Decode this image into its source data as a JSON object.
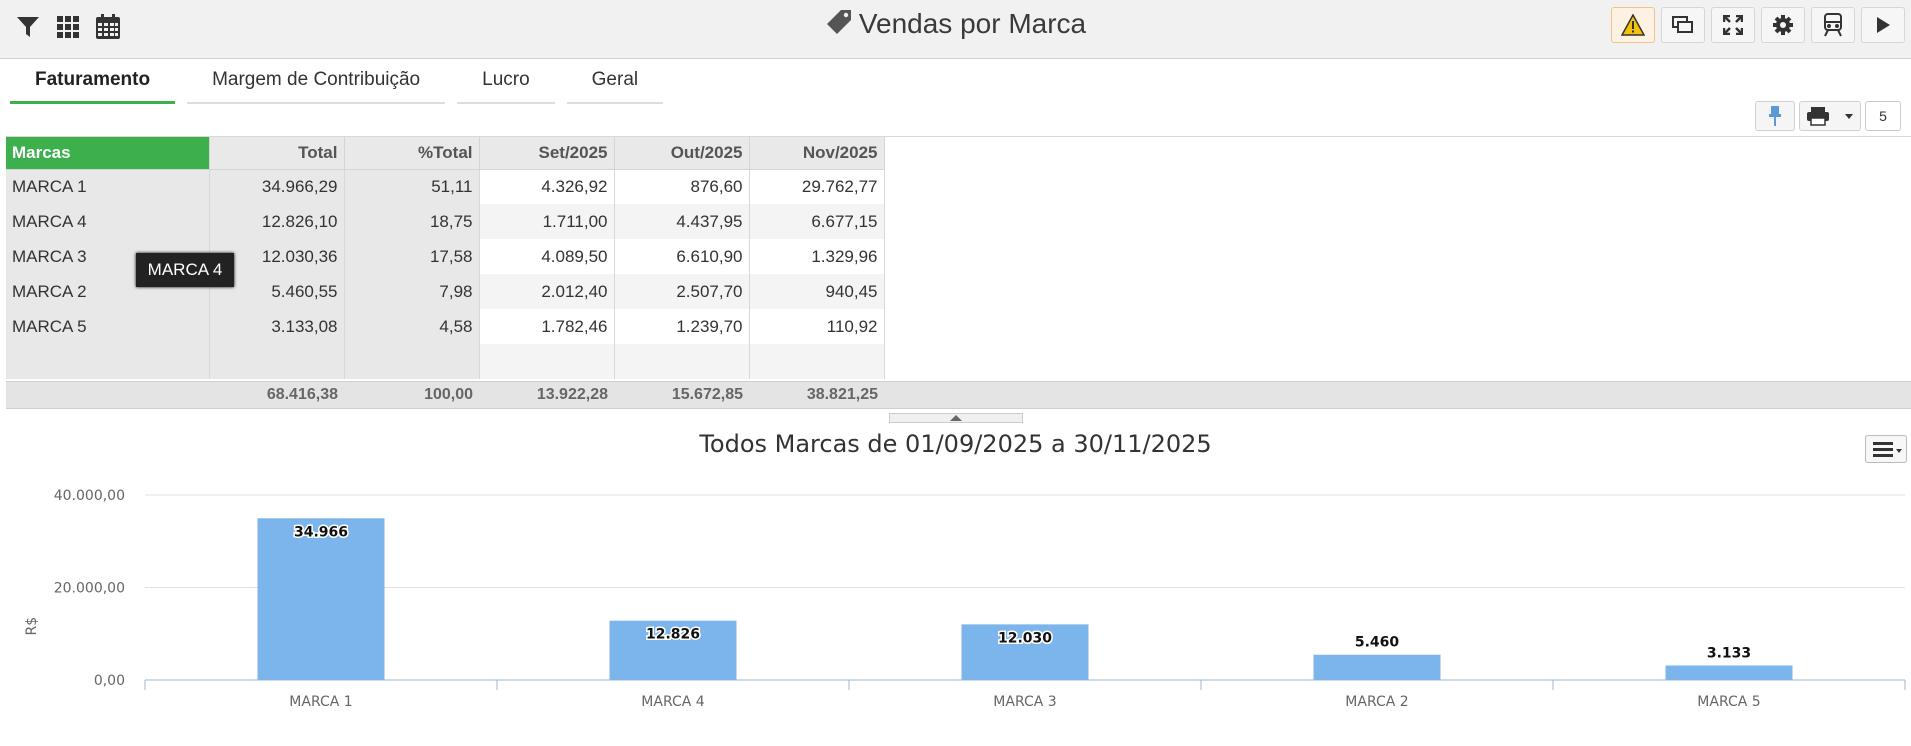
{
  "header": {
    "title": "Vendas por Marca",
    "left_icons": [
      "filter-icon",
      "grid-icon",
      "calendar-icon"
    ],
    "right_buttons": [
      "warning-icon",
      "windows-icon",
      "fullscreen-icon",
      "gear-icon",
      "train-icon",
      "play-icon"
    ]
  },
  "tabs": [
    {
      "label": "Faturamento",
      "active": true
    },
    {
      "label": "Margem de Contribuição",
      "active": false
    },
    {
      "label": "Lucro",
      "active": false
    },
    {
      "label": "Geral",
      "active": false
    }
  ],
  "toolbar": {
    "page_count": "5"
  },
  "table": {
    "headers": [
      "Marcas",
      "Total",
      "%Total",
      "Set/2025",
      "Out/2025",
      "Nov/2025"
    ],
    "rows": [
      [
        "MARCA 1",
        "34.966,29",
        "51,11",
        "4.326,92",
        "876,60",
        "29.762,77"
      ],
      [
        "MARCA 4",
        "12.826,10",
        "18,75",
        "1.711,00",
        "4.437,95",
        "6.677,15"
      ],
      [
        "MARCA 3",
        "12.030,36",
        "17,58",
        "4.089,50",
        "6.610,90",
        "1.329,96"
      ],
      [
        "MARCA 2",
        "5.460,55",
        "7,98",
        "2.012,40",
        "2.507,70",
        "940,45"
      ],
      [
        "MARCA 5",
        "3.133,08",
        "4,58",
        "1.782,46",
        "1.239,70",
        "110,92"
      ]
    ],
    "totals": [
      "68.416,38",
      "100,00",
      "13.922,28",
      "15.672,85",
      "38.821,25"
    ]
  },
  "tooltip": "MARCA 4",
  "chart_data": {
    "type": "bar",
    "title": "Todos Marcas de 01/09/2025 a 30/11/2025",
    "ylabel": "R$",
    "categories": [
      "MARCA 1",
      "MARCA 4",
      "MARCA 3",
      "MARCA 2",
      "MARCA 5"
    ],
    "values": [
      34966,
      12826,
      12030,
      5460,
      3133
    ],
    "data_labels": [
      "34.966",
      "12.826",
      "12.030",
      "5.460",
      "3.133"
    ],
    "yticks": [
      "0,00",
      "20.000,00",
      "40.000,00"
    ],
    "ytick_values": [
      0,
      20000,
      40000
    ],
    "ylim": [
      0,
      40000
    ],
    "grid": true,
    "bar_color": "#7cb5ec"
  },
  "colors": {
    "accent": "#3cb04c"
  }
}
